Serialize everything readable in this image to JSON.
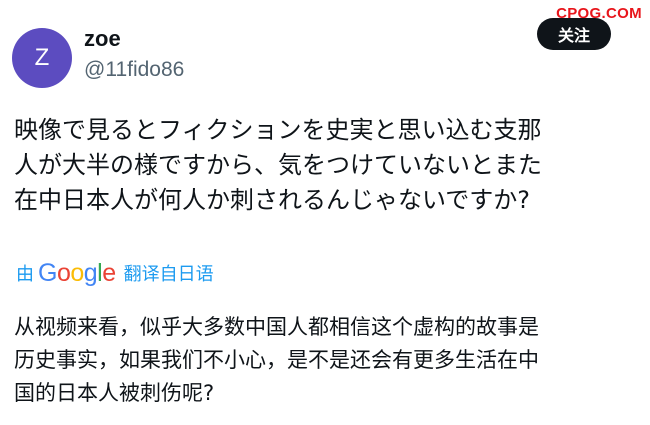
{
  "watermark": "CPQG.COM",
  "author": {
    "avatar_letter": "Z",
    "display_name": "zoe",
    "handle": "@11fido86"
  },
  "follow_button": "关注",
  "post": {
    "original_lines": [
      "映像で見るとフィクションを史実と思い込む支那",
      "人が大半の様ですから、気をつけていないとまた",
      "在中日本人が何人か刺されるんじゃないですか?"
    ],
    "translation": {
      "by": "由",
      "provider_letters": [
        "G",
        "o",
        "o",
        "g",
        "l",
        "e"
      ],
      "provider_colors": [
        "#4285f4",
        "#ea4335",
        "#fbbc05",
        "#4285f4",
        "#34a853",
        "#ea4335"
      ],
      "link": "翻译自日语"
    },
    "translated_lines": [
      "从视频来看，似乎大多数中国人都相信这个虚构的故事是",
      "历史事实，如果我们不小心，是不是还会有更多生活在中",
      "国的日本人被刺伤呢?"
    ]
  },
  "colors": {
    "avatar_bg": "#5c4cc0",
    "link_blue": "#1d9bf0",
    "watermark_red": "#e8151b"
  }
}
